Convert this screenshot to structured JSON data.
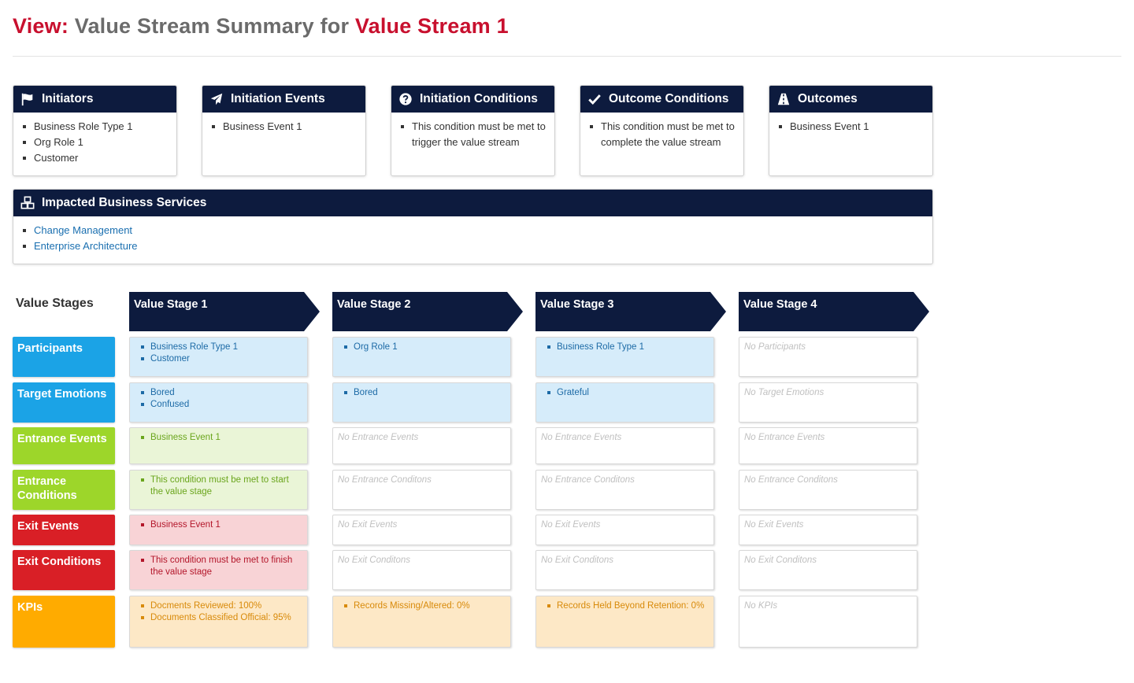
{
  "view_title": {
    "prefix": "View:",
    "middle": " Value Stream Summary for ",
    "stream_name": "Value Stream 1"
  },
  "summary_cards": [
    {
      "title": "Initiators",
      "icon": "flag-icon",
      "items": [
        "Business Role Type 1",
        "Org Role 1",
        "Customer"
      ]
    },
    {
      "title": "Initiation Events",
      "icon": "paper-plane-icon",
      "items": [
        "Business Event 1"
      ]
    },
    {
      "title": "Initiation Conditions",
      "icon": "question-circle-icon",
      "items": [
        "This condition must be met to trigger the value stream"
      ]
    },
    {
      "title": "Outcome Conditions",
      "icon": "check-icon",
      "items": [
        "This condition must be met to complete the value stream"
      ]
    },
    {
      "title": "Outcomes",
      "icon": "road-icon",
      "items": [
        "Business Event 1"
      ]
    }
  ],
  "impacted_services": {
    "title": "Impacted Business Services",
    "icon": "cubes-icon",
    "items": [
      "Change Management",
      "Enterprise Architecture"
    ]
  },
  "value_stages_label": "Value Stages",
  "stages": [
    "Value Stage 1",
    "Value Stage 2",
    "Value Stage 3",
    "Value Stage 4"
  ],
  "rows": [
    {
      "label": "Participants",
      "color": "#1ba3e6",
      "theme": "blue",
      "cells": [
        [
          "Business Role Type 1",
          "Customer"
        ],
        [
          "Org Role 1"
        ],
        [
          "Business Role Type 1"
        ],
        []
      ],
      "empty_text": "No Participants"
    },
    {
      "label": "Target Emotions",
      "color": "#1ba3e6",
      "theme": "blue",
      "cells": [
        [
          "Bored",
          "Confused"
        ],
        [
          "Bored"
        ],
        [
          "Grateful"
        ],
        []
      ],
      "empty_text": "No Target Emotions"
    },
    {
      "label": "Entrance Events",
      "color": "#9dd62a",
      "theme": "green",
      "cells": [
        [
          "Business Event 1"
        ],
        [],
        [],
        []
      ],
      "empty_text": "No Entrance Events"
    },
    {
      "label": "Entrance Conditions",
      "color": "#9dd62a",
      "theme": "green",
      "cells": [
        [
          "This condition must be met to start the value stage"
        ],
        [],
        [],
        []
      ],
      "empty_text": "No Entrance Conditons"
    },
    {
      "label": "Exit Events",
      "color": "#d91f26",
      "theme": "red",
      "cells": [
        [
          "Business Event 1"
        ],
        [],
        [],
        []
      ],
      "empty_text": "No Exit Events"
    },
    {
      "label": "Exit Conditions",
      "color": "#d91f26",
      "theme": "red",
      "cells": [
        [
          "This condition must be met to finish the value stage"
        ],
        [],
        [],
        []
      ],
      "empty_text": "No Exit Conditons"
    },
    {
      "label": "KPIs",
      "color": "#ffab00",
      "theme": "orange",
      "cells": [
        [
          "Docments Reviewed: 100%",
          "Documents Classified Official: 95%"
        ],
        [
          "Records Missing/Altered: 0%"
        ],
        [
          "Records Held Beyond Retention: 0%"
        ],
        []
      ],
      "empty_text": "No KPIs"
    }
  ]
}
